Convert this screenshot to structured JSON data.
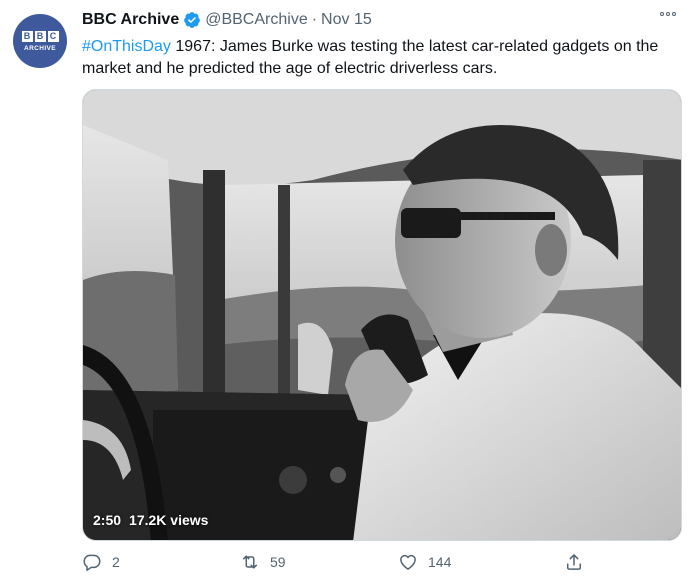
{
  "author": {
    "display_name": "BBC Archive",
    "handle": "@BBCArchive",
    "separator": "·",
    "date": "Nov 15",
    "avatar_top": "BBC",
    "avatar_bottom": "ARCHIVE"
  },
  "tweet": {
    "hashtag": "#OnThisDay",
    "text": " 1967: James Burke was testing the latest car-related gadgets on the market and he predicted the age of electric driverless cars."
  },
  "video": {
    "duration": "2:50",
    "views": "17.2K views"
  },
  "actions": {
    "replies": "2",
    "retweets": "59",
    "likes": "144"
  },
  "icons": {
    "verified": "verified-badge-icon",
    "more": "more-options-icon",
    "reply": "reply-icon",
    "retweet": "retweet-icon",
    "like": "heart-icon",
    "share": "share-icon"
  },
  "colors": {
    "accent": "#1d9bf0",
    "secondary_text": "#536471",
    "avatar_bg": "#3f5a9c"
  }
}
